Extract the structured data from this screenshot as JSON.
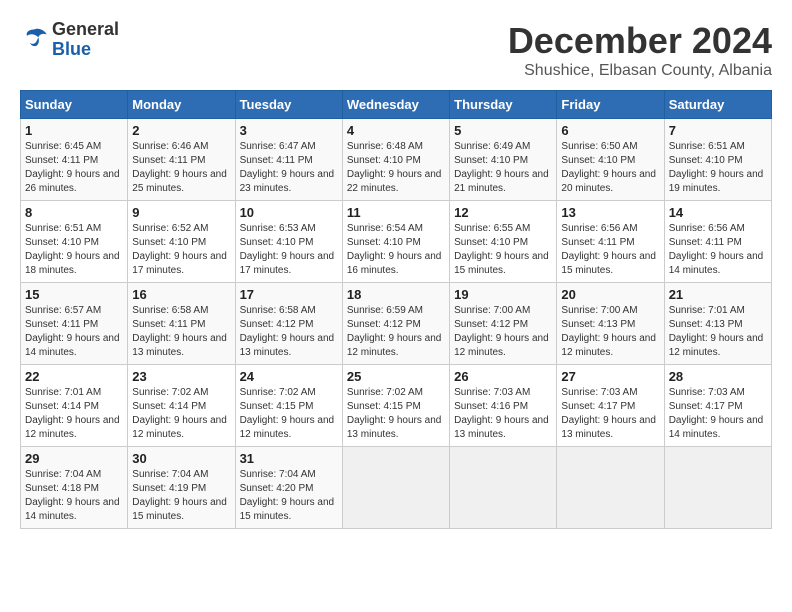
{
  "logo": {
    "general": "General",
    "blue": "Blue"
  },
  "header": {
    "month": "December 2024",
    "location": "Shushice, Elbasan County, Albania"
  },
  "weekdays": [
    "Sunday",
    "Monday",
    "Tuesday",
    "Wednesday",
    "Thursday",
    "Friday",
    "Saturday"
  ],
  "weeks": [
    [
      {
        "day": "1",
        "sunrise": "Sunrise: 6:45 AM",
        "sunset": "Sunset: 4:11 PM",
        "daylight": "Daylight: 9 hours and 26 minutes."
      },
      {
        "day": "2",
        "sunrise": "Sunrise: 6:46 AM",
        "sunset": "Sunset: 4:11 PM",
        "daylight": "Daylight: 9 hours and 25 minutes."
      },
      {
        "day": "3",
        "sunrise": "Sunrise: 6:47 AM",
        "sunset": "Sunset: 4:11 PM",
        "daylight": "Daylight: 9 hours and 23 minutes."
      },
      {
        "day": "4",
        "sunrise": "Sunrise: 6:48 AM",
        "sunset": "Sunset: 4:10 PM",
        "daylight": "Daylight: 9 hours and 22 minutes."
      },
      {
        "day": "5",
        "sunrise": "Sunrise: 6:49 AM",
        "sunset": "Sunset: 4:10 PM",
        "daylight": "Daylight: 9 hours and 21 minutes."
      },
      {
        "day": "6",
        "sunrise": "Sunrise: 6:50 AM",
        "sunset": "Sunset: 4:10 PM",
        "daylight": "Daylight: 9 hours and 20 minutes."
      },
      {
        "day": "7",
        "sunrise": "Sunrise: 6:51 AM",
        "sunset": "Sunset: 4:10 PM",
        "daylight": "Daylight: 9 hours and 19 minutes."
      }
    ],
    [
      {
        "day": "8",
        "sunrise": "Sunrise: 6:51 AM",
        "sunset": "Sunset: 4:10 PM",
        "daylight": "Daylight: 9 hours and 18 minutes."
      },
      {
        "day": "9",
        "sunrise": "Sunrise: 6:52 AM",
        "sunset": "Sunset: 4:10 PM",
        "daylight": "Daylight: 9 hours and 17 minutes."
      },
      {
        "day": "10",
        "sunrise": "Sunrise: 6:53 AM",
        "sunset": "Sunset: 4:10 PM",
        "daylight": "Daylight: 9 hours and 17 minutes."
      },
      {
        "day": "11",
        "sunrise": "Sunrise: 6:54 AM",
        "sunset": "Sunset: 4:10 PM",
        "daylight": "Daylight: 9 hours and 16 minutes."
      },
      {
        "day": "12",
        "sunrise": "Sunrise: 6:55 AM",
        "sunset": "Sunset: 4:10 PM",
        "daylight": "Daylight: 9 hours and 15 minutes."
      },
      {
        "day": "13",
        "sunrise": "Sunrise: 6:56 AM",
        "sunset": "Sunset: 4:11 PM",
        "daylight": "Daylight: 9 hours and 15 minutes."
      },
      {
        "day": "14",
        "sunrise": "Sunrise: 6:56 AM",
        "sunset": "Sunset: 4:11 PM",
        "daylight": "Daylight: 9 hours and 14 minutes."
      }
    ],
    [
      {
        "day": "15",
        "sunrise": "Sunrise: 6:57 AM",
        "sunset": "Sunset: 4:11 PM",
        "daylight": "Daylight: 9 hours and 14 minutes."
      },
      {
        "day": "16",
        "sunrise": "Sunrise: 6:58 AM",
        "sunset": "Sunset: 4:11 PM",
        "daylight": "Daylight: 9 hours and 13 minutes."
      },
      {
        "day": "17",
        "sunrise": "Sunrise: 6:58 AM",
        "sunset": "Sunset: 4:12 PM",
        "daylight": "Daylight: 9 hours and 13 minutes."
      },
      {
        "day": "18",
        "sunrise": "Sunrise: 6:59 AM",
        "sunset": "Sunset: 4:12 PM",
        "daylight": "Daylight: 9 hours and 12 minutes."
      },
      {
        "day": "19",
        "sunrise": "Sunrise: 7:00 AM",
        "sunset": "Sunset: 4:12 PM",
        "daylight": "Daylight: 9 hours and 12 minutes."
      },
      {
        "day": "20",
        "sunrise": "Sunrise: 7:00 AM",
        "sunset": "Sunset: 4:13 PM",
        "daylight": "Daylight: 9 hours and 12 minutes."
      },
      {
        "day": "21",
        "sunrise": "Sunrise: 7:01 AM",
        "sunset": "Sunset: 4:13 PM",
        "daylight": "Daylight: 9 hours and 12 minutes."
      }
    ],
    [
      {
        "day": "22",
        "sunrise": "Sunrise: 7:01 AM",
        "sunset": "Sunset: 4:14 PM",
        "daylight": "Daylight: 9 hours and 12 minutes."
      },
      {
        "day": "23",
        "sunrise": "Sunrise: 7:02 AM",
        "sunset": "Sunset: 4:14 PM",
        "daylight": "Daylight: 9 hours and 12 minutes."
      },
      {
        "day": "24",
        "sunrise": "Sunrise: 7:02 AM",
        "sunset": "Sunset: 4:15 PM",
        "daylight": "Daylight: 9 hours and 12 minutes."
      },
      {
        "day": "25",
        "sunrise": "Sunrise: 7:02 AM",
        "sunset": "Sunset: 4:15 PM",
        "daylight": "Daylight: 9 hours and 13 minutes."
      },
      {
        "day": "26",
        "sunrise": "Sunrise: 7:03 AM",
        "sunset": "Sunset: 4:16 PM",
        "daylight": "Daylight: 9 hours and 13 minutes."
      },
      {
        "day": "27",
        "sunrise": "Sunrise: 7:03 AM",
        "sunset": "Sunset: 4:17 PM",
        "daylight": "Daylight: 9 hours and 13 minutes."
      },
      {
        "day": "28",
        "sunrise": "Sunrise: 7:03 AM",
        "sunset": "Sunset: 4:17 PM",
        "daylight": "Daylight: 9 hours and 14 minutes."
      }
    ],
    [
      {
        "day": "29",
        "sunrise": "Sunrise: 7:04 AM",
        "sunset": "Sunset: 4:18 PM",
        "daylight": "Daylight: 9 hours and 14 minutes."
      },
      {
        "day": "30",
        "sunrise": "Sunrise: 7:04 AM",
        "sunset": "Sunset: 4:19 PM",
        "daylight": "Daylight: 9 hours and 15 minutes."
      },
      {
        "day": "31",
        "sunrise": "Sunrise: 7:04 AM",
        "sunset": "Sunset: 4:20 PM",
        "daylight": "Daylight: 9 hours and 15 minutes."
      },
      null,
      null,
      null,
      null
    ]
  ]
}
